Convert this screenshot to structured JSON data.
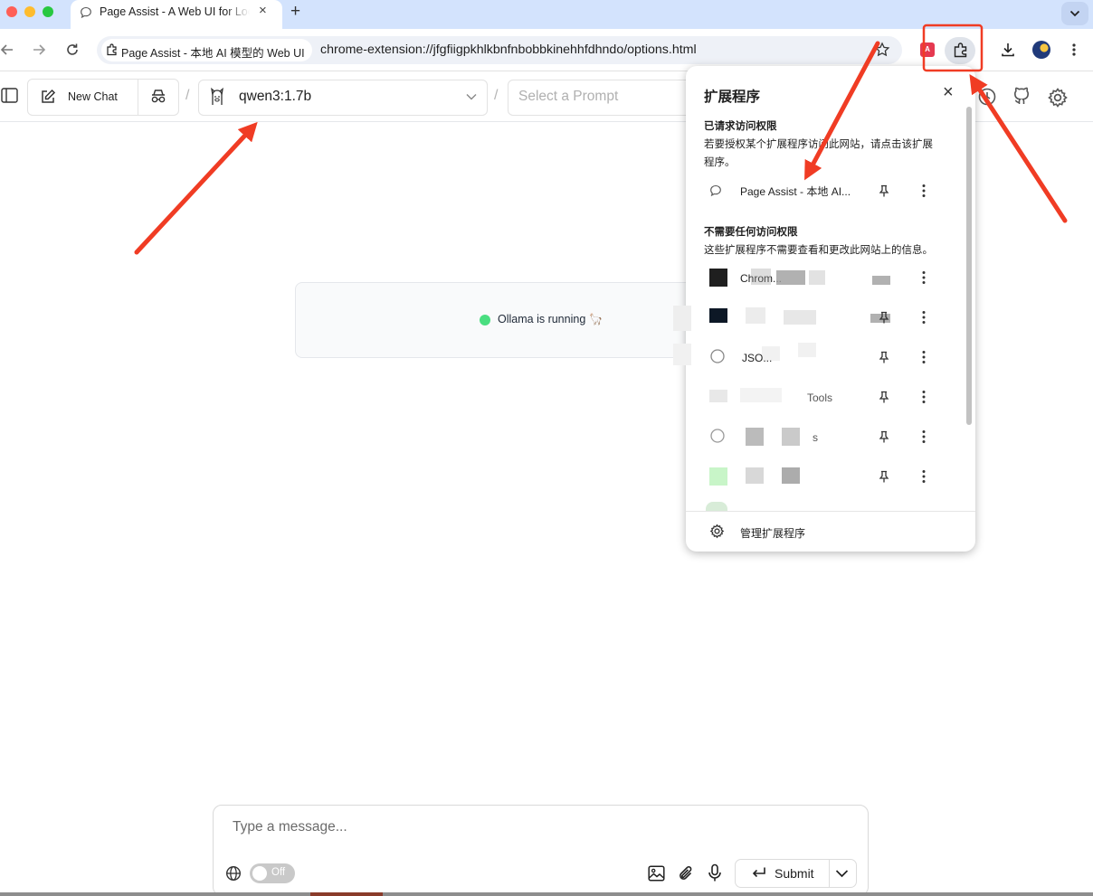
{
  "browser": {
    "tab_title": "Page Assist - A Web UI for Local AI Models",
    "tab_close": "×",
    "new_tab": "+",
    "site_chip_label": "Page Assist - 本地 AI 模型的 Web UI",
    "url": "chrome-extension://jfgfiigpkhlkbnfnbobbkinehhfdhndo/options.html",
    "ext_badge": "A"
  },
  "app": {
    "new_chat_label": "New Chat",
    "model_name": "qwen3:1.7b",
    "prompt_placeholder": "Select a Prompt",
    "status_text": "Ollama is running 🦙"
  },
  "extensions_popup": {
    "title": "扩展程序",
    "close": "×",
    "section_requested_title": "已请求访问权限",
    "section_requested_desc_1": "若要授权某个扩展程序访问此网站，请点击该扩展",
    "section_requested_desc_2": "程序。",
    "requested_item_label": "Page Assist - 本地 AI...",
    "section_none_title": "不需要任何访问权限",
    "section_none_desc": "这些扩展程序不需要查看和更改此网站上的信息。",
    "other_items": [
      {
        "label": "Chrom..."
      },
      {
        "label": ""
      },
      {
        "label": "JSO..."
      },
      {
        "label": "Tools"
      },
      {
        "label": "s"
      },
      {
        "label": ""
      }
    ],
    "manage_label": "管理扩展程序"
  },
  "composer": {
    "placeholder": "Type a message...",
    "toggle_label": "Off",
    "submit_label": "Submit"
  },
  "colors": {
    "annotation_red": "#f03c24",
    "status_green": "#4ade80",
    "tab_strip": "#d3e3fd"
  }
}
